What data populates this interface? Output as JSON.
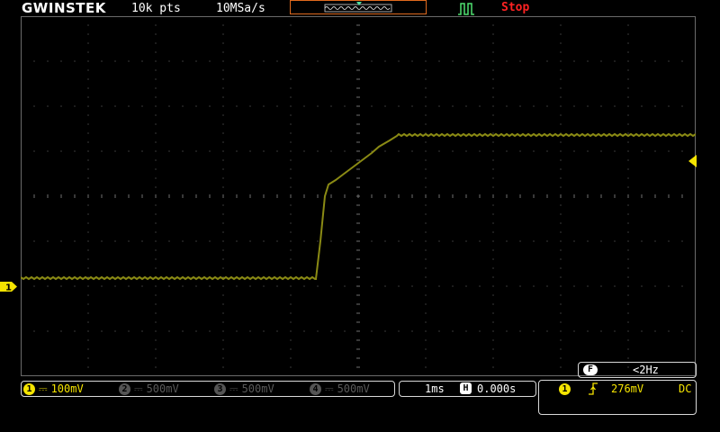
{
  "header": {
    "brand": "GWINSTEK",
    "record_length": "10k pts",
    "sample_rate": "10MSa/s",
    "status": "Stop"
  },
  "colors": {
    "ch1": "#f5e400",
    "trace": "#8a8a14",
    "stop": "#ff2222",
    "trigger_marker": "#ff5a1e",
    "overview_border": "#e06a1e"
  },
  "icons": {
    "trigger_icon": "pulse-trigger-icon",
    "edge_icon": "rising-edge-icon"
  },
  "channels": [
    {
      "id": "1",
      "coupling": "DC",
      "scale": "100mV",
      "active": true
    },
    {
      "id": "2",
      "coupling": "DC",
      "scale": "500mV",
      "active": false
    },
    {
      "id": "3",
      "coupling": "DC",
      "scale": "500mV",
      "active": false
    },
    {
      "id": "4",
      "coupling": "DC",
      "scale": "500mV",
      "active": false
    }
  ],
  "timebase": {
    "scale": "1ms",
    "position": "0.000s"
  },
  "frequency": {
    "badge": "F",
    "value": "<2Hz"
  },
  "trigger": {
    "source": "1",
    "level": "276mV",
    "coupling": "DC"
  },
  "channel_marker": "1"
}
